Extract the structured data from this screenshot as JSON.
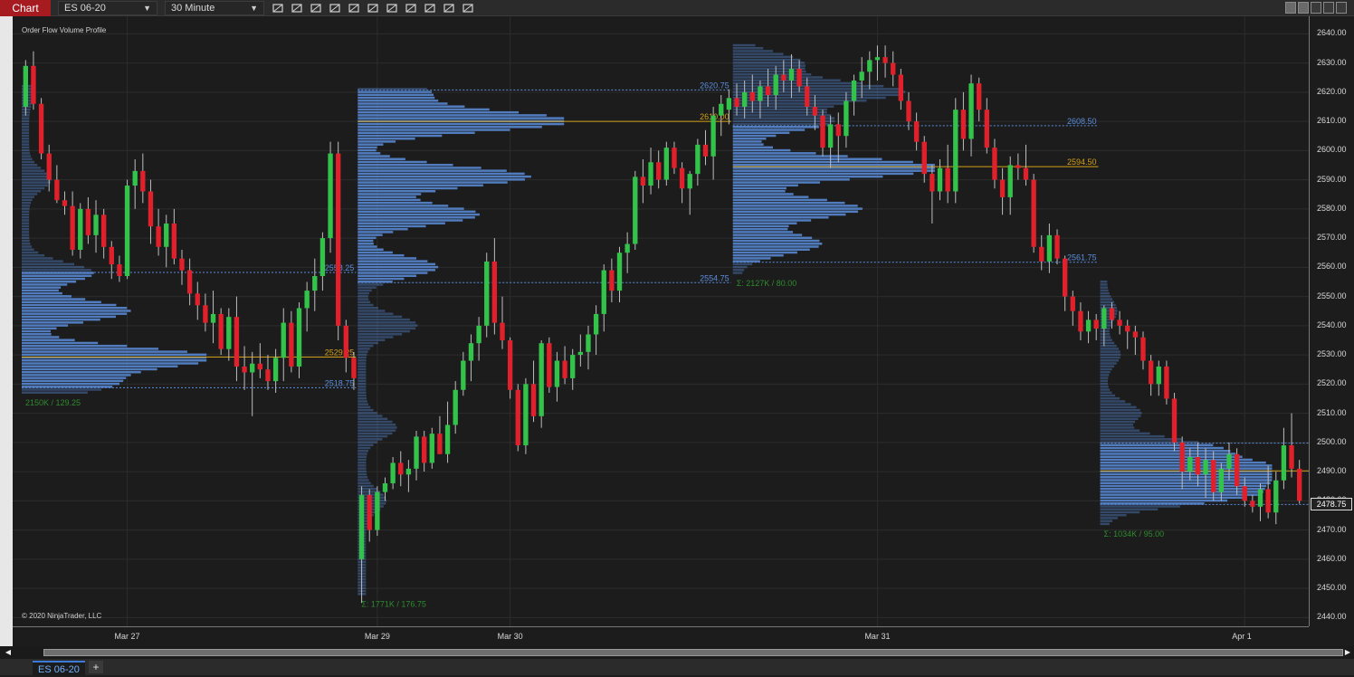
{
  "toolbar": {
    "chart_label": "Chart",
    "instrument": "ES 06-20",
    "interval": "30 Minute",
    "tools": [
      "bars-type-icon",
      "draw-line-icon",
      "zoom-in-icon",
      "zoom-out-icon",
      "pointer-icon",
      "properties-icon",
      "templates-icon",
      "data-box-icon",
      "strategies-icon",
      "indicators-icon",
      "object-tree-icon"
    ]
  },
  "indicator_title": "Order Flow Volume Profile",
  "copyright": "© 2020 NinjaTrader, LLC",
  "tab": {
    "label": "ES 06-20",
    "add_label": "+"
  },
  "colors": {
    "bull": "#33c24a",
    "bear": "#e0202a",
    "profile": "#5b8ddb",
    "poc": "#d4a017",
    "va_line": "#5b8ddb",
    "stats": "#2f8a2f",
    "grid": "#2c2c2c"
  },
  "chart_data": {
    "type": "candlestick",
    "title": "Order Flow Volume Profile",
    "ylim": [
      2437,
      2646
    ],
    "y_ticks": [
      2440,
      2450,
      2460,
      2470,
      2480,
      2490,
      2500,
      2510,
      2520,
      2530,
      2540,
      2550,
      2560,
      2570,
      2580,
      2590,
      2600,
      2610,
      2620,
      2630,
      2640
    ],
    "y_tick_labels": [
      "2440.00",
      "2450.00",
      "2460.00",
      "2470.00",
      "2480.00",
      "2490.00",
      "2500.00",
      "2510.00",
      "2520.00",
      "2530.00",
      "2540.00",
      "2550.00",
      "2560.00",
      "2570.00",
      "2580.00",
      "2590.00",
      "2600.00",
      "2610.00",
      "2620.00",
      "2630.00",
      "2640.00"
    ],
    "x_labels": [
      {
        "label": "Mar 27",
        "bar": 13
      },
      {
        "label": "Mar 29",
        "bar": 45
      },
      {
        "label": "Mar 30",
        "bar": 62
      },
      {
        "label": "Mar 31",
        "bar": 109
      },
      {
        "label": "Apr 1",
        "bar": 156
      }
    ],
    "last_price": "2478.75",
    "grid": true,
    "candles": [
      [
        2615,
        2631,
        2612,
        2629
      ],
      [
        2629,
        2634,
        2614,
        2616
      ],
      [
        2616,
        2618,
        2597,
        2599
      ],
      [
        2599,
        2602,
        2586,
        2590
      ],
      [
        2590,
        2595,
        2582,
        2583
      ],
      [
        2583,
        2586,
        2578,
        2581
      ],
      [
        2581,
        2586,
        2564,
        2566
      ],
      [
        2566,
        2582,
        2563,
        2580
      ],
      [
        2580,
        2584,
        2568,
        2571
      ],
      [
        2571,
        2583,
        2565,
        2578
      ],
      [
        2578,
        2580,
        2563,
        2567
      ],
      [
        2567,
        2569,
        2556,
        2561
      ],
      [
        2561,
        2564,
        2555,
        2557
      ],
      [
        2557,
        2590,
        2556,
        2588
      ],
      [
        2588,
        2597,
        2580,
        2593
      ],
      [
        2593,
        2599,
        2582,
        2586
      ],
      [
        2586,
        2590,
        2568,
        2574
      ],
      [
        2574,
        2580,
        2564,
        2567
      ],
      [
        2567,
        2578,
        2560,
        2575
      ],
      [
        2575,
        2580,
        2561,
        2563
      ],
      [
        2563,
        2566,
        2554,
        2559
      ],
      [
        2559,
        2563,
        2547,
        2551
      ],
      [
        2551,
        2555,
        2542,
        2547
      ],
      [
        2547,
        2551,
        2538,
        2541
      ],
      [
        2541,
        2552,
        2534,
        2544
      ],
      [
        2544,
        2546,
        2530,
        2532
      ],
      [
        2532,
        2546,
        2528,
        2543
      ],
      [
        2543,
        2550,
        2521,
        2526
      ],
      [
        2526,
        2533,
        2518,
        2524
      ],
      [
        2524,
        2531,
        2509,
        2527
      ],
      [
        2527,
        2534,
        2522,
        2525
      ],
      [
        2525,
        2530,
        2518,
        2521
      ],
      [
        2521,
        2532,
        2517,
        2529
      ],
      [
        2529,
        2546,
        2521,
        2541
      ],
      [
        2541,
        2545,
        2524,
        2526
      ],
      [
        2526,
        2548,
        2522,
        2546
      ],
      [
        2546,
        2555,
        2538,
        2552
      ],
      [
        2552,
        2563,
        2545,
        2557
      ],
      [
        2557,
        2572,
        2552,
        2570
      ],
      [
        2570,
        2603,
        2565,
        2599
      ],
      [
        2599,
        2603,
        2535,
        2540
      ],
      [
        2540,
        2542,
        2524,
        2529
      ],
      [
        2529,
        2531,
        2518,
        2522
      ],
      [
        2460,
        2485,
        2445,
        2482
      ],
      [
        2482,
        2484,
        2466,
        2470
      ],
      [
        2470,
        2485,
        2468,
        2483
      ],
      [
        2483,
        2488,
        2480,
        2486
      ],
      [
        2486,
        2495,
        2484,
        2493
      ],
      [
        2493,
        2497,
        2485,
        2489
      ],
      [
        2489,
        2494,
        2483,
        2491
      ],
      [
        2491,
        2504,
        2487,
        2502
      ],
      [
        2502,
        2504,
        2490,
        2493
      ],
      [
        2493,
        2505,
        2491,
        2503
      ],
      [
        2503,
        2509,
        2496,
        2496
      ],
      [
        2496,
        2514,
        2493,
        2506
      ],
      [
        2506,
        2521,
        2503,
        2518
      ],
      [
        2518,
        2531,
        2516,
        2528
      ],
      [
        2528,
        2537,
        2521,
        2534
      ],
      [
        2534,
        2543,
        2528,
        2540
      ],
      [
        2540,
        2565,
        2536,
        2562
      ],
      [
        2562,
        2570,
        2537,
        2541
      ],
      [
        2541,
        2550,
        2532,
        2535
      ],
      [
        2535,
        2536,
        2515,
        2518
      ],
      [
        2518,
        2520,
        2497,
        2499
      ],
      [
        2499,
        2522,
        2496,
        2520
      ],
      [
        2520,
        2528,
        2507,
        2509
      ],
      [
        2509,
        2535,
        2505,
        2534
      ],
      [
        2534,
        2536,
        2517,
        2519
      ],
      [
        2519,
        2531,
        2514,
        2528
      ],
      [
        2528,
        2533,
        2520,
        2522
      ],
      [
        2522,
        2532,
        2518,
        2530
      ],
      [
        2530,
        2537,
        2526,
        2531
      ],
      [
        2531,
        2540,
        2525,
        2537
      ],
      [
        2537,
        2547,
        2530,
        2544
      ],
      [
        2544,
        2561,
        2538,
        2559
      ],
      [
        2559,
        2563,
        2548,
        2552
      ],
      [
        2552,
        2567,
        2548,
        2565
      ],
      [
        2565,
        2572,
        2558,
        2568
      ],
      [
        2568,
        2593,
        2566,
        2591
      ],
      [
        2591,
        2597,
        2582,
        2588
      ],
      [
        2588,
        2601,
        2585,
        2596
      ],
      [
        2596,
        2600,
        2587,
        2590
      ],
      [
        2590,
        2603,
        2588,
        2601
      ],
      [
        2601,
        2603,
        2592,
        2594
      ],
      [
        2594,
        2596,
        2582,
        2587
      ],
      [
        2587,
        2593,
        2578,
        2592
      ],
      [
        2592,
        2604,
        2588,
        2602
      ],
      [
        2602,
        2607,
        2595,
        2598
      ],
      [
        2598,
        2615,
        2590,
        2612
      ],
      [
        2612,
        2619,
        2605,
        2616
      ],
      [
        2614,
        2621,
        2609,
        2618
      ],
      [
        2618,
        2623,
        2612,
        2615
      ],
      [
        2615,
        2624,
        2611,
        2620
      ],
      [
        2620,
        2626,
        2613,
        2617
      ],
      [
        2617,
        2624,
        2611,
        2622
      ],
      [
        2622,
        2628,
        2615,
        2619
      ],
      [
        2619,
        2629,
        2614,
        2626
      ],
      [
        2626,
        2631,
        2620,
        2624
      ],
      [
        2624,
        2633,
        2618,
        2628
      ],
      [
        2628,
        2631,
        2620,
        2622
      ],
      [
        2622,
        2625,
        2612,
        2615
      ],
      [
        2615,
        2619,
        2607,
        2612
      ],
      [
        2612,
        2614,
        2598,
        2601
      ],
      [
        2601,
        2612,
        2594,
        2609
      ],
      [
        2609,
        2613,
        2596,
        2605
      ],
      [
        2605,
        2620,
        2601,
        2617
      ],
      [
        2617,
        2626,
        2612,
        2624
      ],
      [
        2624,
        2632,
        2618,
        2627
      ],
      [
        2627,
        2634,
        2621,
        2631
      ],
      [
        2631,
        2636,
        2624,
        2632
      ],
      [
        2632,
        2636,
        2625,
        2630
      ],
      [
        2630,
        2634,
        2622,
        2626
      ],
      [
        2626,
        2628,
        2614,
        2617
      ],
      [
        2617,
        2620,
        2607,
        2610
      ],
      [
        2610,
        2613,
        2600,
        2603
      ],
      [
        2603,
        2605,
        2589,
        2592
      ],
      [
        2592,
        2595,
        2575,
        2586
      ],
      [
        2586,
        2597,
        2583,
        2594
      ],
      [
        2594,
        2602,
        2582,
        2586
      ],
      [
        2586,
        2618,
        2582,
        2614
      ],
      [
        2614,
        2620,
        2600,
        2604
      ],
      [
        2604,
        2626,
        2598,
        2623
      ],
      [
        2623,
        2625,
        2610,
        2614
      ],
      [
        2614,
        2618,
        2599,
        2601
      ],
      [
        2601,
        2604,
        2587,
        2590
      ],
      [
        2590,
        2594,
        2578,
        2584
      ],
      [
        2584,
        2598,
        2578,
        2595
      ],
      [
        2595,
        2599,
        2590,
        2594
      ],
      [
        2594,
        2602,
        2588,
        2590
      ],
      [
        2590,
        2592,
        2565,
        2567
      ],
      [
        2567,
        2571,
        2559,
        2562
      ],
      [
        2562,
        2575,
        2558,
        2571
      ],
      [
        2571,
        2573,
        2561,
        2563
      ],
      [
        2563,
        2564,
        2545,
        2550
      ],
      [
        2550,
        2552,
        2540,
        2545
      ],
      [
        2545,
        2548,
        2535,
        2538
      ],
      [
        2538,
        2545,
        2534,
        2542
      ],
      [
        2542,
        2544,
        2535,
        2539
      ],
      [
        2539,
        2547,
        2533,
        2546
      ],
      [
        2546,
        2548,
        2539,
        2542
      ],
      [
        2542,
        2545,
        2537,
        2540
      ],
      [
        2540,
        2542,
        2532,
        2538
      ],
      [
        2538,
        2540,
        2530,
        2536
      ],
      [
        2536,
        2538,
        2525,
        2528
      ],
      [
        2528,
        2530,
        2516,
        2520
      ],
      [
        2520,
        2528,
        2516,
        2526
      ],
      [
        2526,
        2528,
        2513,
        2515
      ],
      [
        2515,
        2517,
        2497,
        2500
      ],
      [
        2500,
        2502,
        2484,
        2490
      ],
      [
        2490,
        2498,
        2487,
        2495
      ],
      [
        2495,
        2500,
        2485,
        2489
      ],
      [
        2489,
        2498,
        2481,
        2494
      ],
      [
        2494,
        2497,
        2480,
        2483
      ],
      [
        2483,
        2493,
        2480,
        2491
      ],
      [
        2491,
        2500,
        2487,
        2496
      ],
      [
        2496,
        2498,
        2482,
        2485
      ],
      [
        2485,
        2488,
        2478,
        2480
      ],
      [
        2480,
        2482,
        2476,
        2478
      ],
      [
        2478,
        2486,
        2473,
        2484
      ],
      [
        2484,
        2492,
        2474,
        2476
      ],
      [
        2476,
        2490,
        2472,
        2487
      ],
      [
        2487,
        2505,
        2484,
        2499
      ],
      [
        2499,
        2510,
        2488,
        2491
      ],
      [
        2491,
        2494,
        2479,
        2480
      ]
    ],
    "profiles": [
      {
        "start_bar": 0,
        "end_bar": 43,
        "hi": 2622,
        "lo": 2517,
        "vah": "2558.25",
        "poc": "2529.25",
        "val": "2518.75",
        "vah_v": 2558.25,
        "poc_v": 2529.25,
        "val_v": 2518.75,
        "stats": "2150K / 129.25",
        "peaks": [
          [
            2529,
            1
          ],
          [
            2520,
            0.45
          ],
          [
            2545,
            0.55
          ],
          [
            2558,
            0.35
          ],
          [
            2590,
            0.12
          ],
          [
            2620,
            0.03
          ]
        ]
      },
      {
        "start_bar": 43,
        "end_bar": 91,
        "hi": 2621,
        "lo": 2448,
        "vah": "2620.75",
        "poc": "2610.00",
        "val": "2554.75",
        "vah_v": 2620.75,
        "poc_v": 2610,
        "val_v": 2554.75,
        "stats": "Σ: 1771K / 176.75",
        "peaks": [
          [
            2610,
            1
          ],
          [
            2591,
            0.8
          ],
          [
            2578,
            0.55
          ],
          [
            2560,
            0.35
          ],
          [
            2540,
            0.25
          ],
          [
            2620,
            0.3
          ],
          [
            2505,
            0.15
          ],
          [
            2480,
            0.1
          ]
        ]
      },
      {
        "start_bar": 91,
        "end_bar": 138,
        "hi": 2636,
        "lo": 2558,
        "vah": "2608.50",
        "poc": "2594.50",
        "val": "2561.75",
        "vah_v": 2608.5,
        "poc_v": 2594.5,
        "val_v": 2561.75,
        "stats": "Σ: 2127K / 80.00",
        "peaks": [
          [
            2594,
            1
          ],
          [
            2580,
            0.6
          ],
          [
            2620,
            0.8
          ],
          [
            2610,
            0.45
          ],
          [
            2630,
            0.3
          ],
          [
            2568,
            0.4
          ]
        ]
      },
      {
        "start_bar": 138,
        "end_bar": 178,
        "hi": 2555,
        "lo": 2472,
        "vah": "2499.75",
        "poc": "2490.25",
        "val": "2478.75",
        "vah_v": 2499.75,
        "poc_v": 2490.25,
        "val_v": 2478.75,
        "stats": "Σ: 1034K / 95.00",
        "peaks": [
          [
            2490,
            1
          ],
          [
            2482,
            0.8
          ],
          [
            2498,
            0.6
          ],
          [
            2510,
            0.2
          ],
          [
            2530,
            0.08
          ],
          [
            2545,
            0.06
          ]
        ]
      }
    ]
  }
}
